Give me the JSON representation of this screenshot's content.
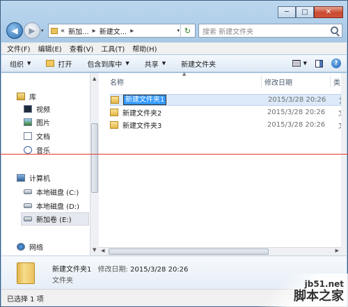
{
  "window": {
    "back_glyph": "◀",
    "forward_glyph": "▶",
    "minimize": "─",
    "maximize": "□",
    "close": "✕"
  },
  "address": {
    "overflow": "«",
    "crumbs": [
      "新加...",
      "新建文..."
    ],
    "separator": "▸",
    "dropdown": "▾"
  },
  "search": {
    "placeholder": "搜索 新建文件夹"
  },
  "menu": [
    "文件(F)",
    "编辑(E)",
    "查看(V)",
    "工具(T)",
    "帮助(H)"
  ],
  "commands": {
    "organize": "组织",
    "open": "打开",
    "include": "包含到库中",
    "share": "共享",
    "new_folder": "新建文件夹",
    "arrow": "▼"
  },
  "nav": {
    "library": "库",
    "video": "视频",
    "pictures": "图片",
    "documents": "文档",
    "music": "音乐",
    "computer": "计算机",
    "drive_c": "本地磁盘 (C:)",
    "drive_d": "本地磁盘 (D:)",
    "drive_e": "新加卷 (E:)",
    "network": "网络"
  },
  "columns": {
    "name": "名称",
    "date": "修改日期",
    "type": "类"
  },
  "files": [
    {
      "name": "新建文件夹1",
      "date": "2015/3/28 20:26",
      "type": "文"
    },
    {
      "name": "新建文件夹2",
      "date": "2015/3/28 20:26",
      "type": "文"
    },
    {
      "name": "新建文件夹3",
      "date": "2015/3/28 20:26",
      "type": "文"
    }
  ],
  "details": {
    "name": "新建文件夹1",
    "date_label": "修改日期:",
    "date": "2015/3/28 20:26",
    "type": "文件夹"
  },
  "status": "已选择 1 项",
  "watermark": {
    "site": "jb51.net",
    "text": "脚本之家"
  }
}
